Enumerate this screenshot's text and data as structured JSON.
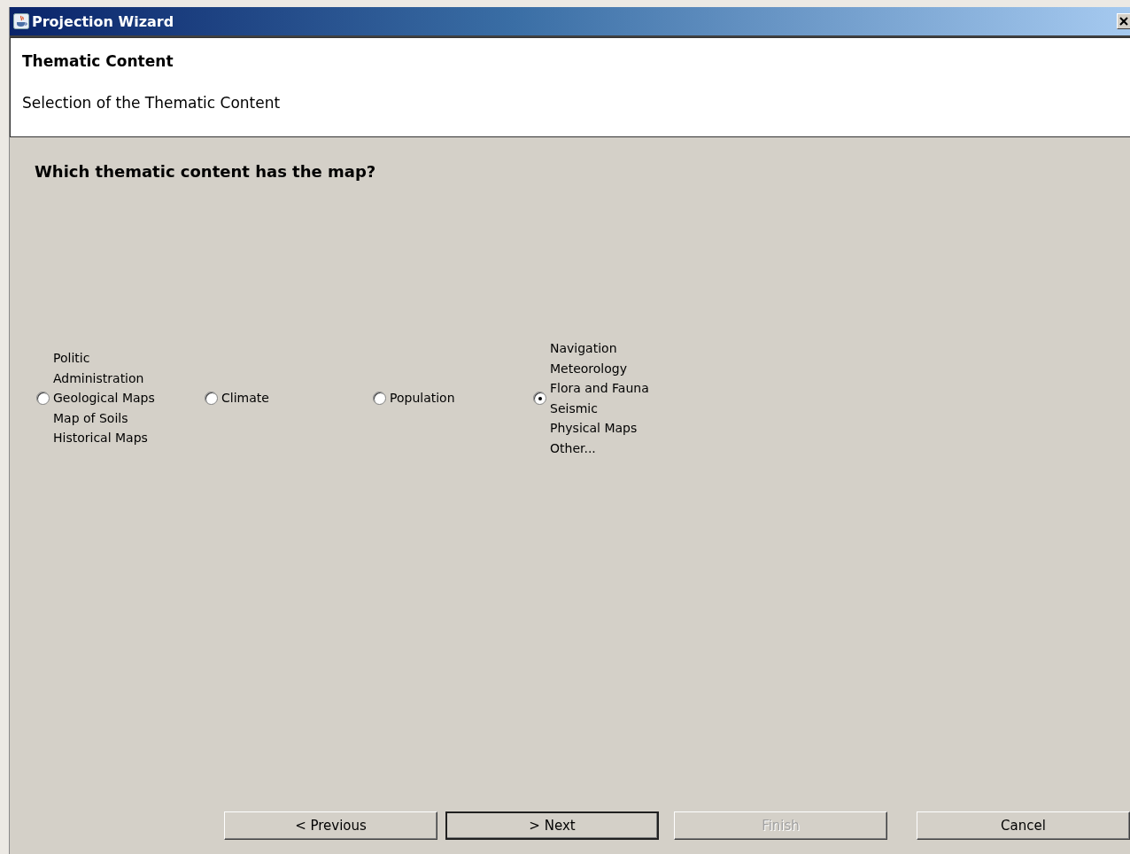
{
  "window": {
    "title": "Projection Wizard"
  },
  "header": {
    "title": "Thematic Content",
    "subtitle": "Selection of the Thematic Content"
  },
  "question": "Which thematic content has the map?",
  "options": [
    {
      "lines": [
        "Politic",
        "Administration",
        "Geological Maps",
        "Map of Soils",
        "Historical Maps"
      ],
      "selected": false
    },
    {
      "lines": [
        "Climate"
      ],
      "selected": false
    },
    {
      "lines": [
        "Population"
      ],
      "selected": false
    },
    {
      "lines": [
        "Navigation",
        "Meteorology",
        "Flora and Fauna",
        "Seismic",
        "Physical Maps",
        "Other..."
      ],
      "selected": true
    }
  ],
  "buttons": [
    {
      "label": "< Previous",
      "disabled": false,
      "default": false
    },
    {
      "label": "> Next",
      "disabled": false,
      "default": true
    },
    {
      "label": "Finish",
      "disabled": true,
      "default": false
    },
    {
      "label": "Cancel",
      "disabled": false,
      "default": false
    }
  ]
}
